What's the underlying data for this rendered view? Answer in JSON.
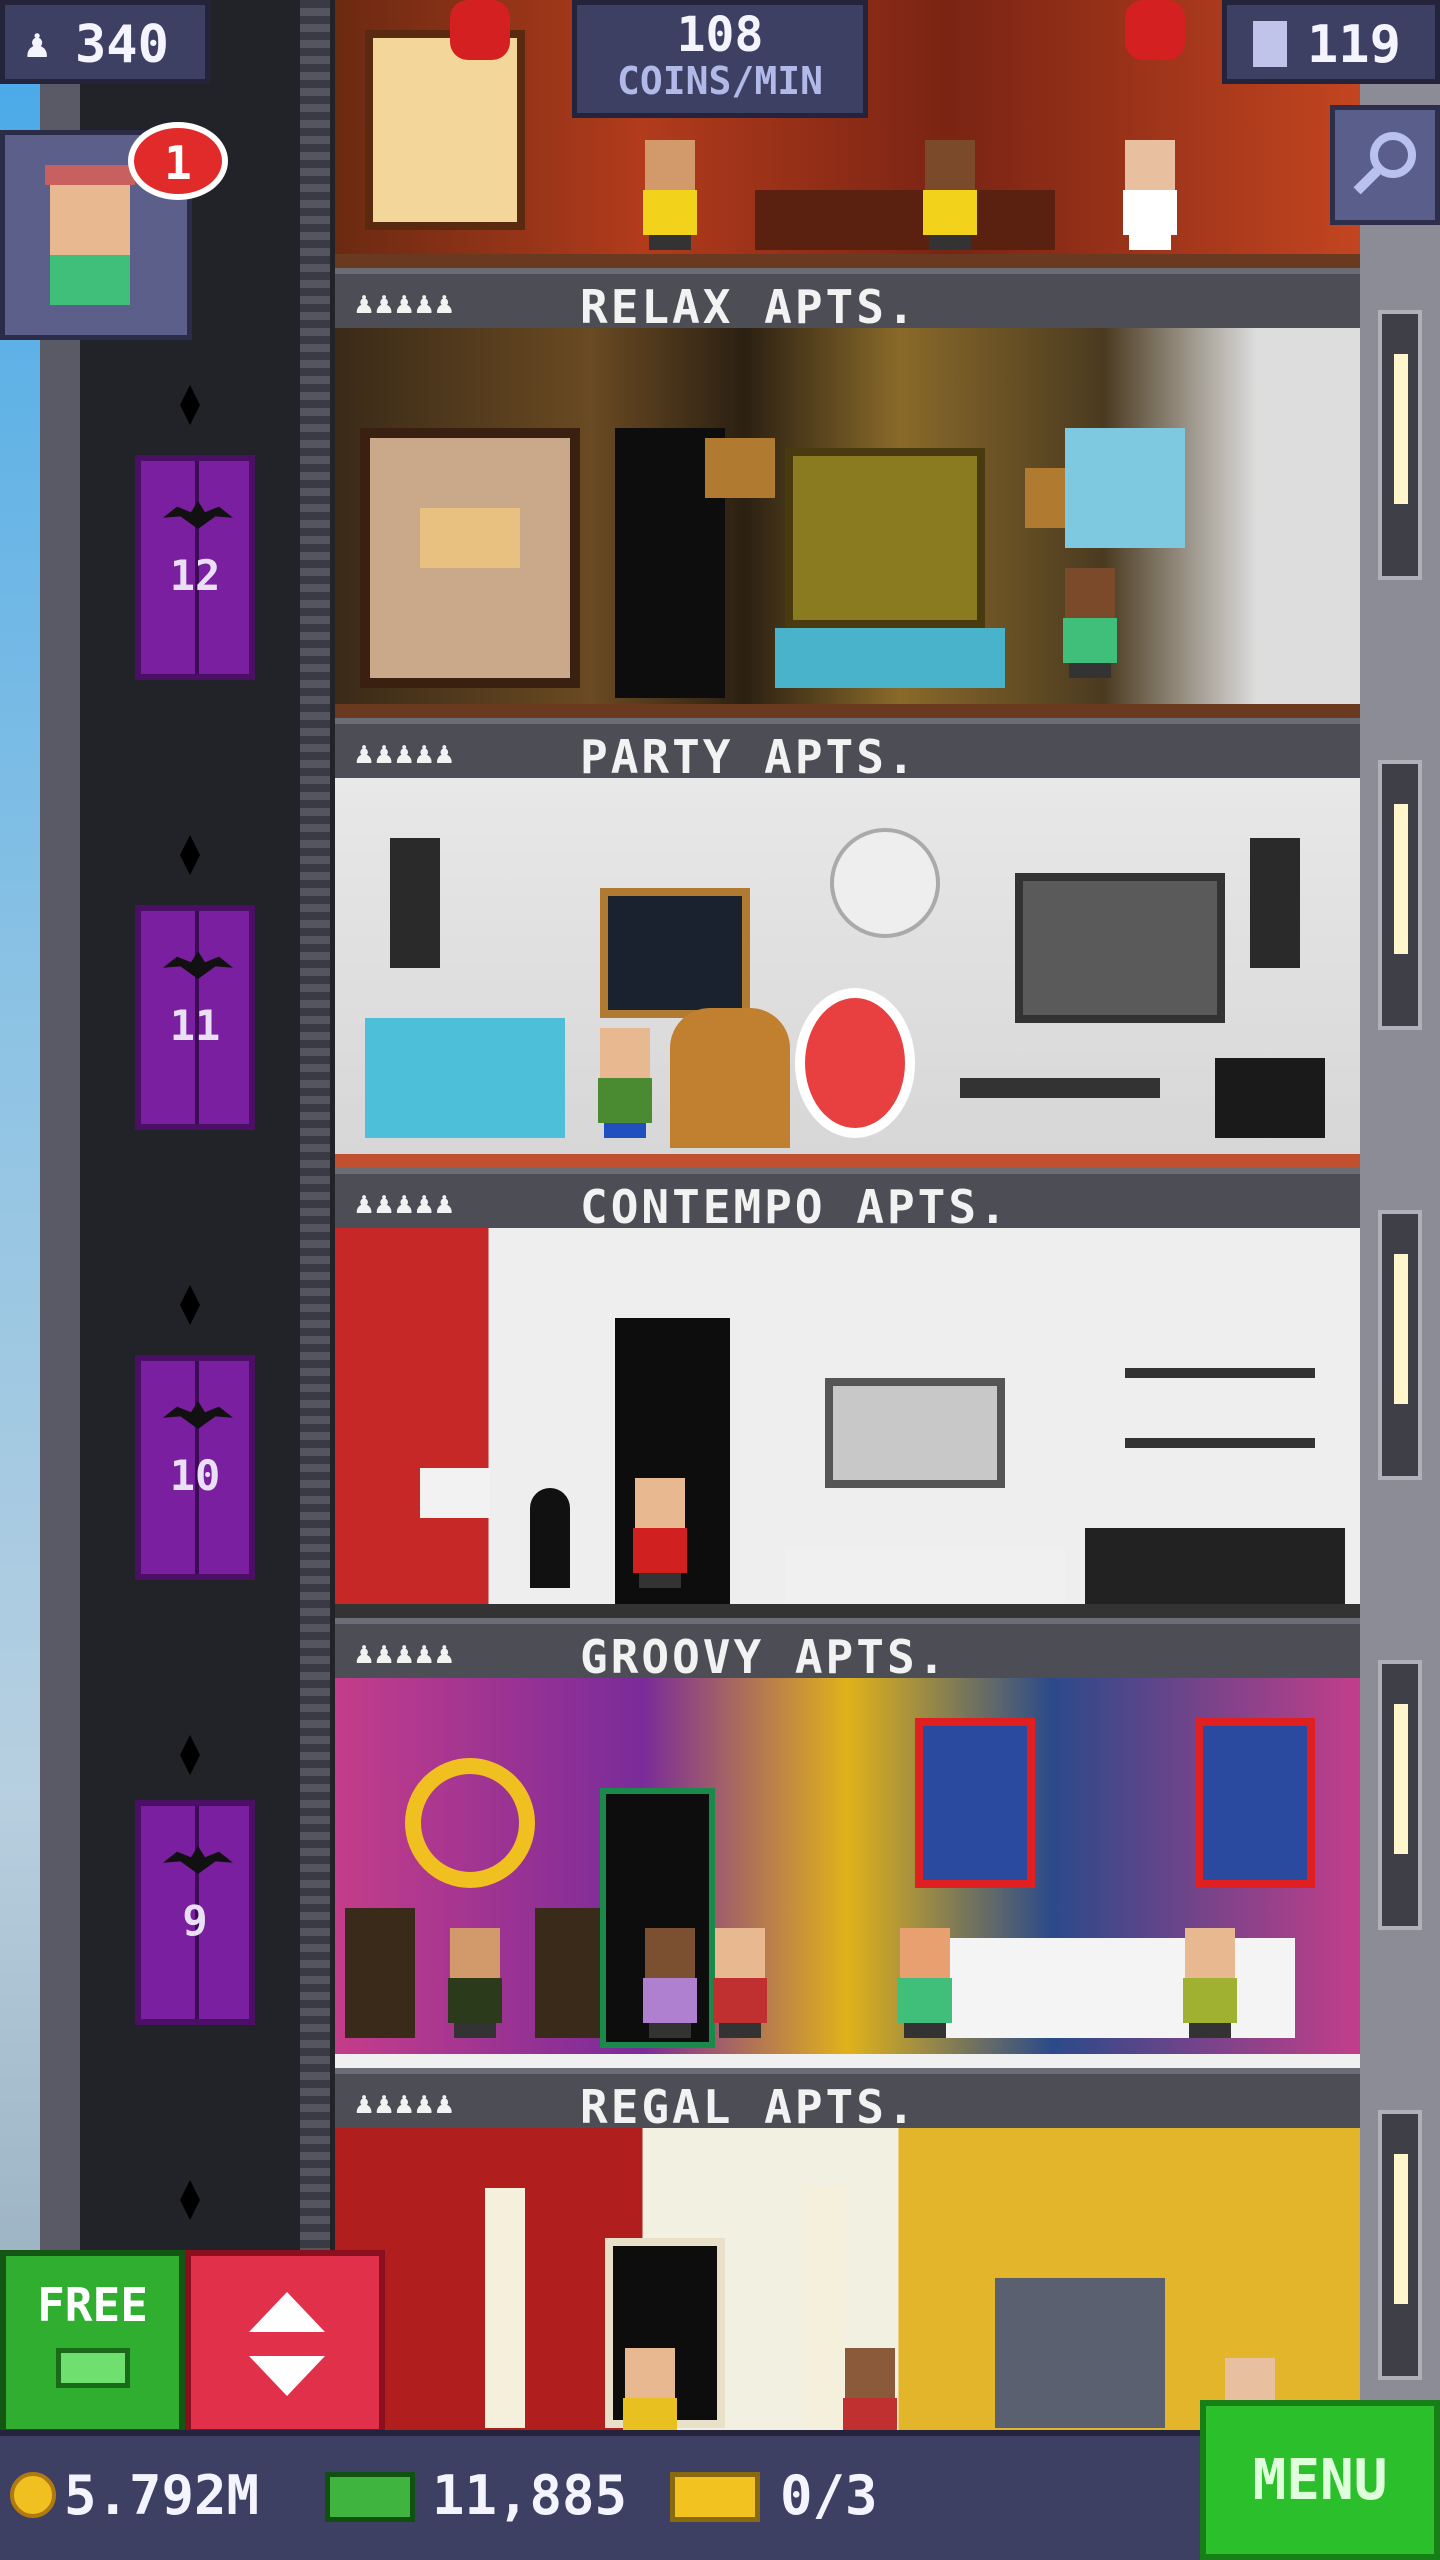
{
  "hud": {
    "population": "340",
    "coins_per_min": "108",
    "coins_per_min_unit": "COINS/MIN",
    "floors": "119",
    "visitor_badge_count": "1",
    "population_icon": "person-icon",
    "floors_icon": "building-icon",
    "search_icon": "magnifier-icon"
  },
  "elevator": {
    "floor_numbers": [
      "12",
      "11",
      "10",
      "9"
    ]
  },
  "floors": [
    {
      "id": "relax",
      "label": "RELAX APTS.",
      "residents_icons": "♟♟♟♟♟"
    },
    {
      "id": "party",
      "label": "PARTY APTS.",
      "residents_icons": "♟♟♟♟♟"
    },
    {
      "id": "contempo",
      "label": "CONTEMPO APTS.",
      "residents_icons": "♟♟♟♟♟"
    },
    {
      "id": "groovy",
      "label": "GROOVY APTS.",
      "residents_icons": "♟♟♟♟♟"
    },
    {
      "id": "regal",
      "label": "REGAL APTS.",
      "residents_icons": "♟♟♟♟♟"
    }
  ],
  "buttons": {
    "free": "FREE",
    "menu": "MENU"
  },
  "bottom_bar": {
    "coins": "5.792M",
    "tower_bux": "11,885",
    "tickets": "0/3"
  },
  "colors": {
    "hud_bg": "#3d3f63",
    "elevator_purple": "#7a1fa0",
    "menu_green": "#2cbf2c",
    "elevator_btn_red": "#e0304a",
    "badge_red": "#e12b2b"
  }
}
